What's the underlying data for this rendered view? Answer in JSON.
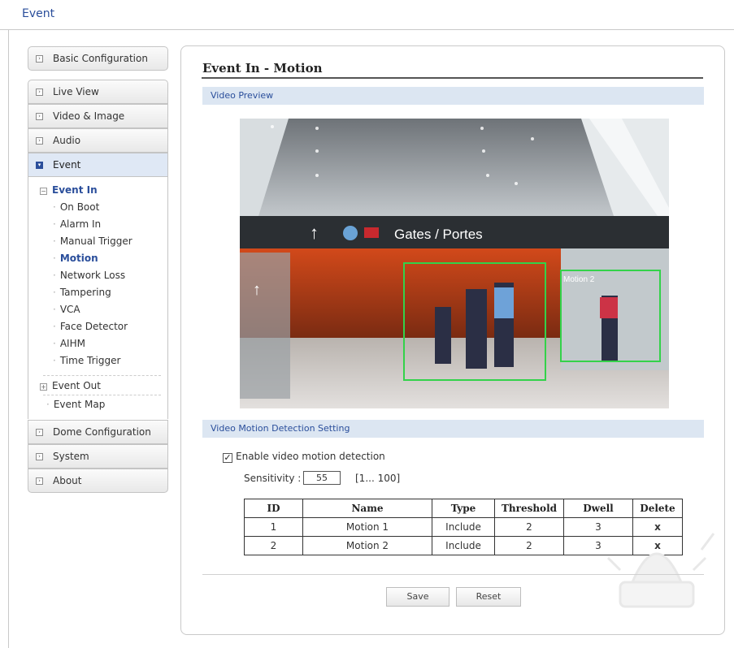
{
  "topbar": {
    "title": "Event"
  },
  "sidebar": {
    "basic_config": "Basic Configuration",
    "items": [
      {
        "label": "Live View"
      },
      {
        "label": "Video & Image"
      },
      {
        "label": "Audio"
      },
      {
        "label": "Event"
      }
    ],
    "event_in": "Event In",
    "sub_items": [
      "On Boot",
      "Alarm In",
      "Manual Trigger",
      "Motion",
      "Network Loss",
      "Tampering",
      "VCA",
      "Face Detector",
      "AIHM",
      "Time Trigger"
    ],
    "event_out": "Event Out",
    "event_map": "Event Map",
    "bottom_items": [
      {
        "label": "Dome Configuration"
      },
      {
        "label": "System"
      },
      {
        "label": "About"
      }
    ]
  },
  "main": {
    "title": "Event In - Motion",
    "preview_section": "Video Preview",
    "preview": {
      "sign_text": "Gates / Portes",
      "region_label": "Motion 2"
    },
    "detection_section": "Video Motion Detection Setting",
    "enable_label": "Enable video motion detection",
    "enable_checked": true,
    "sensitivity_label": "Sensitivity :",
    "sensitivity_value": "55",
    "sensitivity_range": "[1... 100]",
    "table": {
      "headers": [
        "ID",
        "Name",
        "Type",
        "Threshold",
        "Dwell",
        "Delete"
      ],
      "rows": [
        {
          "id": "1",
          "name": "Motion 1",
          "type": "Include",
          "threshold": "2",
          "dwell": "3",
          "delete": "x"
        },
        {
          "id": "2",
          "name": "Motion 2",
          "type": "Include",
          "threshold": "2",
          "dwell": "3",
          "delete": "x"
        }
      ]
    },
    "save_label": "Save",
    "reset_label": "Reset"
  }
}
